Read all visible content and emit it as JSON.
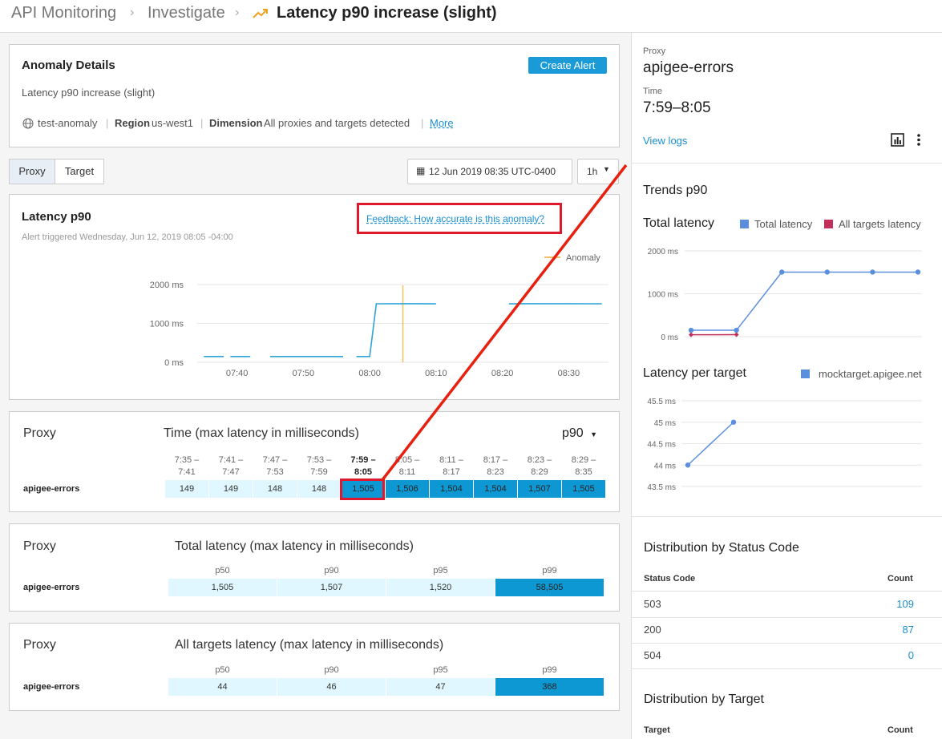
{
  "header": {
    "crumbs": [
      "API Monitoring",
      "Investigate"
    ],
    "title": "Latency p90 increase (slight)",
    "trend_icon_color": "#f0a020"
  },
  "anomaly": {
    "heading": "Anomaly Details",
    "create_alert": "Create Alert",
    "description": "Latency p90 increase (slight)",
    "env": "test-anomaly",
    "region_label": "Region",
    "region_value": "us-west1",
    "dimension_label": "Dimension",
    "dimension_value": "All proxies and targets detected",
    "more": "More"
  },
  "controls": {
    "proxy_tab": "Proxy",
    "target_tab": "Target",
    "date": "12 Jun 2019 08:35 UTC-0400",
    "range": "1h"
  },
  "latency_card": {
    "title": "Latency p90",
    "feedback": "Feedback: How accurate is this anomaly?",
    "triggered": "Alert triggered Wednesday, Jun 12, 2019 08:05 -04:00",
    "anomaly_legend": "Anomaly"
  },
  "chart_data": [
    {
      "type": "line",
      "title": "Latency p90",
      "x": [
        "07:40",
        "07:50",
        "08:00",
        "08:10",
        "08:20",
        "08:30"
      ],
      "y_ticks": [
        "2000 ms",
        "1000 ms",
        "0 ms"
      ],
      "ylim": [
        0,
        2000
      ],
      "series": [
        {
          "values_x": [
            "07:35",
            "07:38",
            "07:39",
            "07:42",
            "07:45",
            "07:56",
            "07:58",
            "08:00",
            "08:01",
            "08:07",
            "08:10",
            "08:21",
            "08:23",
            "08:35"
          ],
          "values_y": [
            149,
            149,
            149,
            149,
            148,
            148,
            148,
            148,
            1505,
            1506,
            1504,
            1504,
            1507,
            1505
          ]
        }
      ],
      "anomaly_at": "08:05",
      "legend": [
        "Anomaly"
      ],
      "colors": {
        "line": "#2ea4d8",
        "anomaly": "#f0c060"
      }
    },
    {
      "type": "line",
      "title": "Total latency",
      "y_ticks": [
        "2000 ms",
        "1000 ms",
        "0 ms"
      ],
      "ylim": [
        0,
        2000
      ],
      "series": [
        {
          "name": "Total latency",
          "values": [
            149,
            149,
            1505,
            1505,
            1505,
            1505
          ],
          "color": "#5b8fdd"
        },
        {
          "name": "All targets latency",
          "values": [
            44,
            46
          ],
          "color": "#c0305a"
        }
      ]
    },
    {
      "type": "line",
      "title": "Latency per target",
      "y_ticks": [
        "45.5 ms",
        "45 ms",
        "44.5 ms",
        "44 ms",
        "43.5 ms"
      ],
      "ylim": [
        43.5,
        45.5
      ],
      "series": [
        {
          "name": "mocktarget.apigee.net",
          "values": [
            44,
            45
          ],
          "color": "#5b8fdd"
        }
      ]
    }
  ],
  "time_table": {
    "proxy_label": "Proxy",
    "heading": "Time (max latency in milliseconds)",
    "percentile": "p90",
    "columns": [
      {
        "top": "7:35 –",
        "bottom": "7:41"
      },
      {
        "top": "7:41 –",
        "bottom": "7:47"
      },
      {
        "top": "7:47 –",
        "bottom": "7:53"
      },
      {
        "top": "7:53 –",
        "bottom": "7:59"
      },
      {
        "top": "7:59 –",
        "bottom": "8:05"
      },
      {
        "top": "8:05 –",
        "bottom": "8:11"
      },
      {
        "top": "8:11 –",
        "bottom": "8:17"
      },
      {
        "top": "8:17 –",
        "bottom": "8:23"
      },
      {
        "top": "8:23 –",
        "bottom": "8:29"
      },
      {
        "top": "8:29 –",
        "bottom": "8:35"
      }
    ],
    "row_label": "apigee-errors",
    "values": [
      "149",
      "149",
      "148",
      "148",
      "1,505",
      "1,506",
      "1,504",
      "1,504",
      "1,507",
      "1,505"
    ]
  },
  "total_table": {
    "proxy_label": "Proxy",
    "heading": "Total latency (max latency in milliseconds)",
    "columns": [
      "p50",
      "p90",
      "p95",
      "p99"
    ],
    "row_label": "apigee-errors",
    "values": [
      "1,505",
      "1,507",
      "1,520",
      "58,505"
    ]
  },
  "targets_table": {
    "proxy_label": "Proxy",
    "heading": "All targets latency (max latency in milliseconds)",
    "columns": [
      "p50",
      "p90",
      "p95",
      "p99"
    ],
    "row_label": "apigee-errors",
    "values": [
      "44",
      "46",
      "47",
      "368"
    ]
  },
  "right": {
    "proxy_label": "Proxy",
    "proxy_value": "apigee-errors",
    "time_label": "Time",
    "time_value": "7:59–8:05",
    "view_logs": "View logs",
    "trends": "Trends p90",
    "total_latency": "Total latency",
    "legend_total": "Total latency",
    "legend_targets": "All targets latency",
    "per_target": "Latency per target",
    "legend_target": "mocktarget.apigee.net",
    "status_heading": "Distribution by Status Code",
    "status_col1": "Status Code",
    "status_col2": "Count",
    "status_rows": [
      {
        "code": "503",
        "count": "109"
      },
      {
        "code": "200",
        "count": "87"
      },
      {
        "code": "504",
        "count": "0"
      }
    ],
    "target_heading": "Distribution by Target",
    "target_col1": "Target",
    "target_col2": "Count"
  }
}
